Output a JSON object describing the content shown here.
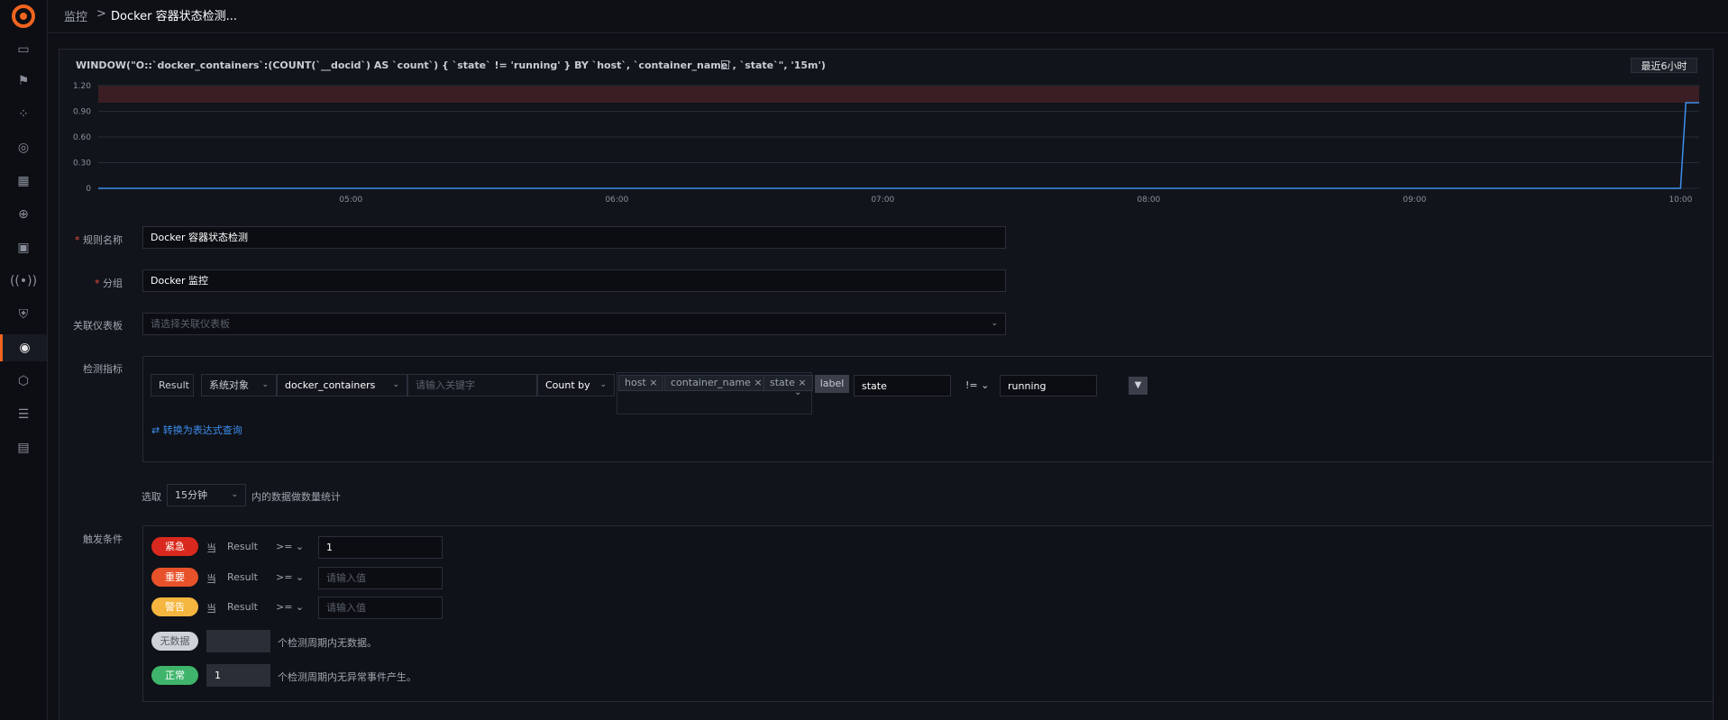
{
  "header": {
    "breadcrumb_root": "监控",
    "breadcrumb_sep": ">",
    "breadcrumb_current": "Docker 容器状态检测..."
  },
  "sidebar": {
    "icons": [
      "dashboard-icon",
      "flag-icon",
      "apps-icon",
      "compass-icon",
      "calendar-icon",
      "target-icon",
      "monitor-icon",
      "signal-icon",
      "shield-icon",
      "radar-icon",
      "cube-icon",
      "sliders-icon",
      "package-icon"
    ]
  },
  "query": {
    "text": "WINDOW(\"O::`docker_containers`:(COUNT(`__docid`) AS `count`) { `state` != 'running' } BY `host`, `container_name`, `state`\", '15m')",
    "range_button": "最近6小时"
  },
  "chart_data": {
    "type": "line",
    "yticks": [
      "1.20",
      "0.90",
      "0.60",
      "0.30",
      "0"
    ],
    "xticks": [
      "05:00",
      "06:00",
      "07:00",
      "08:00",
      "09:00",
      "10:00"
    ],
    "ylim": [
      0,
      1.2
    ],
    "xlim": [
      4.05,
      10.07
    ],
    "threshold_band": [
      1,
      1.2
    ],
    "threshold_color": "#3a1e24",
    "line_color": "#3d8ff0",
    "series": [
      {
        "points": [
          [
            4.05,
            0
          ],
          [
            10.0,
            0
          ],
          [
            10.02,
            1
          ],
          [
            10.07,
            1
          ]
        ]
      }
    ]
  },
  "form": {
    "rule_name_label": "规则名称",
    "rule_name_value": "Docker 容器状态检测",
    "group_label": "分组",
    "group_value": "Docker 监控",
    "dashboard_label": "关联仪表板",
    "dashboard_placeholder": "请选择关联仪表板",
    "required_mark": "*",
    "metric_label": "检测指标",
    "result_label": "Result",
    "source_select": "系统对象",
    "object_select": "docker_containers",
    "keyword_placeholder": "请输入关键字",
    "count_by": "Count by",
    "tags": [
      "host",
      "container_name",
      "state"
    ],
    "filter_label_tag": "label",
    "filter_key": "state",
    "filter_op": "!=",
    "filter_value": "running",
    "switch_link": "⇄ 转换为表达式查询",
    "window_prefix": "选取",
    "window_select": "15分钟",
    "window_suffix": "内的数据做数量统计",
    "trigger_label": "触发条件",
    "when": "当",
    "result": "Result",
    "op_ge": ">=",
    "value_placeholder": "请输入值",
    "levels": [
      {
        "name": "紧急",
        "color": "#d9291e",
        "value": "1"
      },
      {
        "name": "重要",
        "color": "#e8522a",
        "value": ""
      },
      {
        "name": "警告",
        "color": "#f4b63f",
        "value": ""
      }
    ],
    "nodata_badge": "无数据",
    "nodata_color": "#cfd2d6",
    "nodata_value": "",
    "nodata_text": "个检测周期内无数据。",
    "normal_badge": "正常",
    "normal_color": "#3fb56b",
    "normal_value": "1",
    "normal_text": "个检测周期内无异常事件产生。"
  }
}
